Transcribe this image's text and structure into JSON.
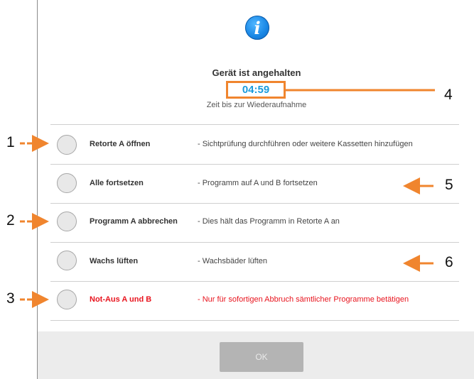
{
  "dialog": {
    "title": "Gerät ist angehalten",
    "countdown": "04:59",
    "subtitle": "Zeit bis zur Wiederaufnahme",
    "ok_label": "OK"
  },
  "options": [
    {
      "label": "Retorte A öffnen",
      "description": "-  Sichtprüfung durchführen oder weitere Kassetten hinzufügen"
    },
    {
      "label": "Alle fortsetzen",
      "description": "-  Programm auf A und B fortsetzen"
    },
    {
      "label": "Programm A abbrechen",
      "description": "-  Dies hält das Programm in Retorte A an"
    },
    {
      "label": "Wachs lüften",
      "description": "-  Wachsbäder lüften"
    },
    {
      "label": "Not-Aus A und B",
      "description": "-  Nur für sofortigen Abbruch sämtlicher Programme betätigen"
    }
  ],
  "callouts": [
    "1",
    "2",
    "3",
    "4",
    "5",
    "6"
  ],
  "colors": {
    "accent_orange": "#f0852e",
    "countdown_blue": "#1a9bdc",
    "danger_red": "#e8141e",
    "info_blue": "#1a88e6"
  }
}
